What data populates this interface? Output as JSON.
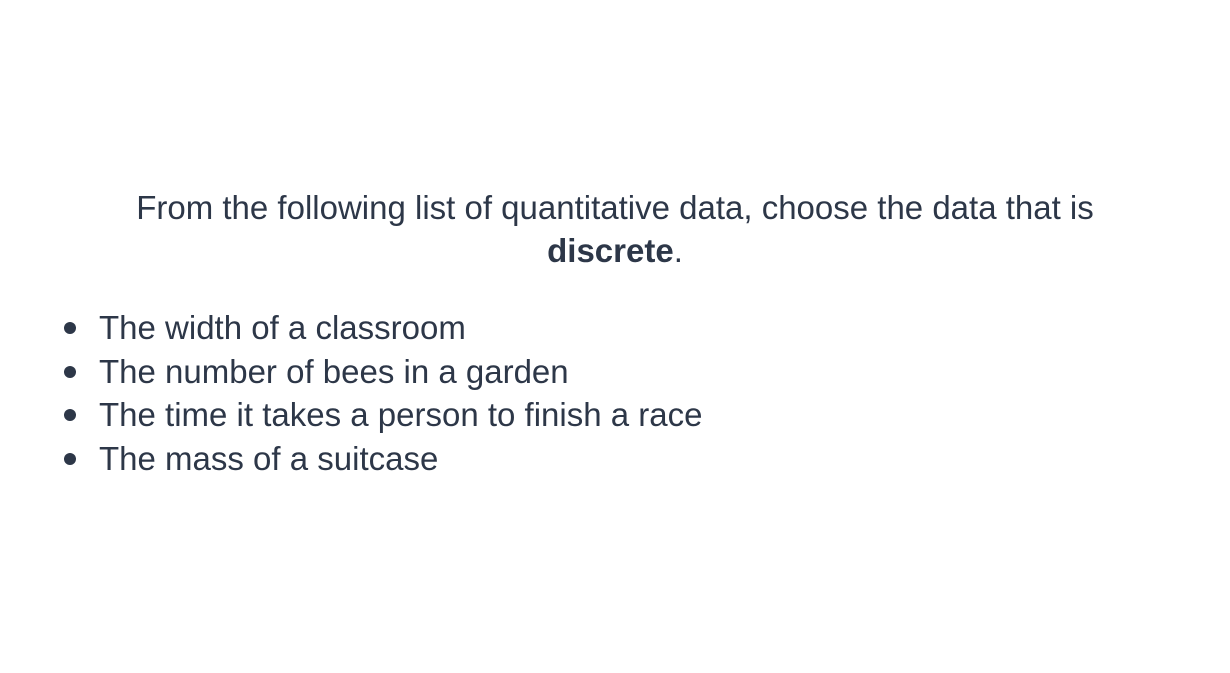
{
  "question": {
    "prefix": "From the following list of quantitative data, choose the data that is",
    "emphasis": "discrete",
    "suffix": "."
  },
  "options": [
    "The width of a classroom",
    "The number of bees in a garden",
    "The time it takes a person to finish a race",
    "The mass of a suitcase"
  ],
  "colors": {
    "text": "#2d3748",
    "background": "#ffffff"
  }
}
